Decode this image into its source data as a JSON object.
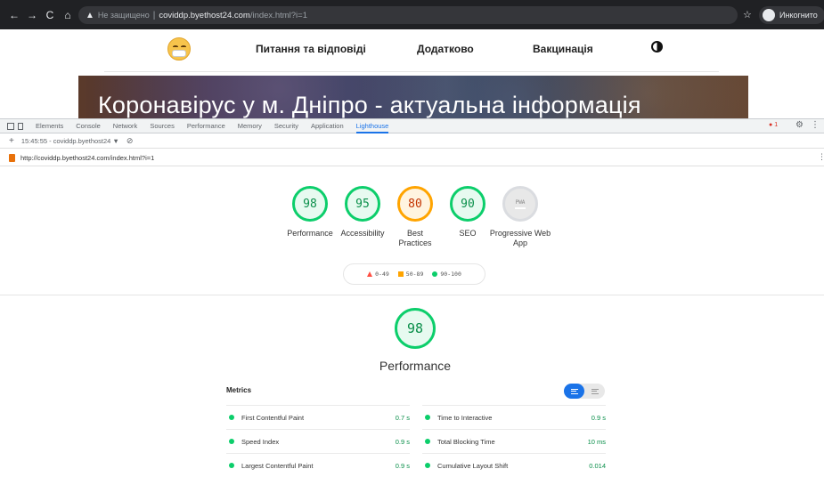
{
  "browser": {
    "insecure_label": "Не защищено",
    "url_host": "coviddp.byethost24.com",
    "url_path": "/index.html?i=1",
    "profile_label": "Инкогнито"
  },
  "site": {
    "nav": [
      "Питання та відповіді",
      "Додатково",
      "Вакцинація"
    ],
    "hero_title": "Коронавірус у м. Дніпро - актуальна інформація"
  },
  "devtools": {
    "tabs": [
      "Elements",
      "Console",
      "Network",
      "Sources",
      "Performance",
      "Memory",
      "Security",
      "Application",
      "Lighthouse"
    ],
    "active_tab": "Lighthouse",
    "error_count": "1",
    "report_selector": "15:45:55 - coviddp.byethost24 ▼",
    "audited_url": "http://coviddp.byethost24.com/index.html?i=1"
  },
  "lighthouse": {
    "scores": [
      {
        "label": "Performance",
        "score": "98",
        "status": "pass"
      },
      {
        "label": "Accessibility",
        "score": "95",
        "status": "pass"
      },
      {
        "label": "Best Practices",
        "score": "80",
        "status": "average"
      },
      {
        "label": "SEO",
        "score": "90",
        "status": "pass"
      },
      {
        "label": "Progressive Web App",
        "score": "PWA",
        "status": "na"
      }
    ],
    "legend": [
      "0-49",
      "50-89",
      "90-100"
    ],
    "section": {
      "score": "98",
      "title": "Performance"
    },
    "metrics_label": "Metrics",
    "metrics": [
      {
        "name": "First Contentful Paint",
        "value": "0.7 s"
      },
      {
        "name": "Time to Interactive",
        "value": "0.9 s"
      },
      {
        "name": "Speed Index",
        "value": "0.9 s"
      },
      {
        "name": "Total Blocking Time",
        "value": "10 ms"
      },
      {
        "name": "Largest Contentful Paint",
        "value": "0.9 s"
      },
      {
        "name": "Cumulative Layout Shift",
        "value": "0.014"
      }
    ]
  },
  "colors": {
    "pass": "#0cce6b",
    "average": "#ffa400",
    "fail": "#ff4e42",
    "accent": "#1a73e8"
  }
}
